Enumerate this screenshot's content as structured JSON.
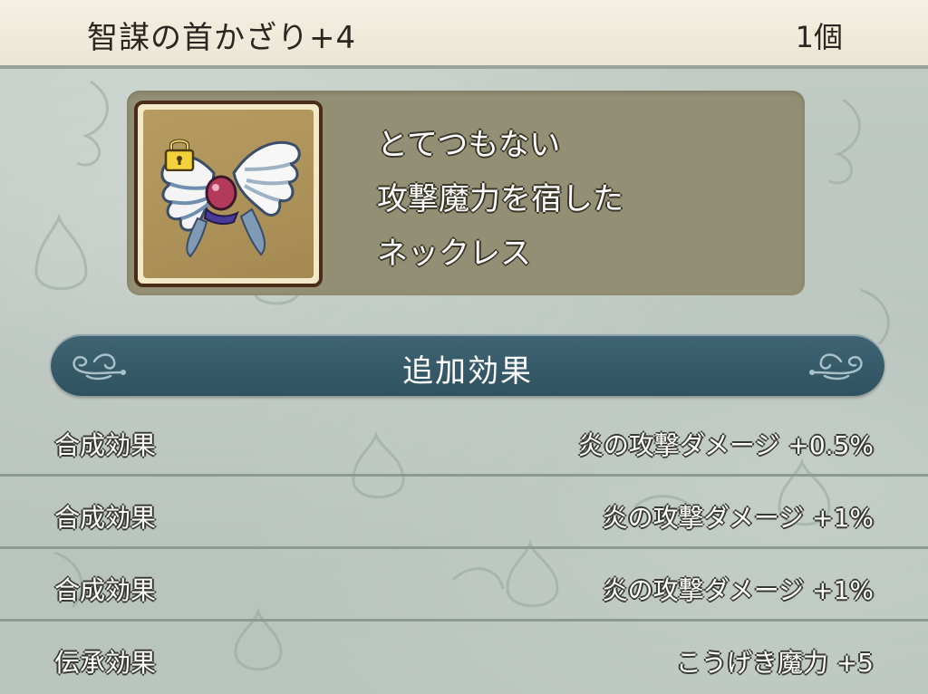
{
  "header": {
    "item_name": "智謀の首かざり+4",
    "quantity": "1個"
  },
  "item": {
    "icon": "winged-necklace-icon",
    "locked": true,
    "lock_icon": "padlock-icon",
    "description_lines": [
      "とてつもない",
      "攻撃魔力を宿した",
      "ネックレス"
    ]
  },
  "section": {
    "title": "追加効果"
  },
  "effects": [
    {
      "name": "合成効果",
      "value": "炎の攻撃ダメージ +0.5%"
    },
    {
      "name": "合成効果",
      "value": "炎の攻撃ダメージ +1%"
    },
    {
      "name": "合成効果",
      "value": "炎の攻撃ダメージ +1%"
    },
    {
      "name": "伝承効果",
      "value": "こうげき魔力 +5"
    }
  ],
  "colors": {
    "header_bg": "#efeadb",
    "card_bg": "#938f75",
    "banner_bg": "#365a68",
    "page_bg": "#bcc7c0"
  }
}
